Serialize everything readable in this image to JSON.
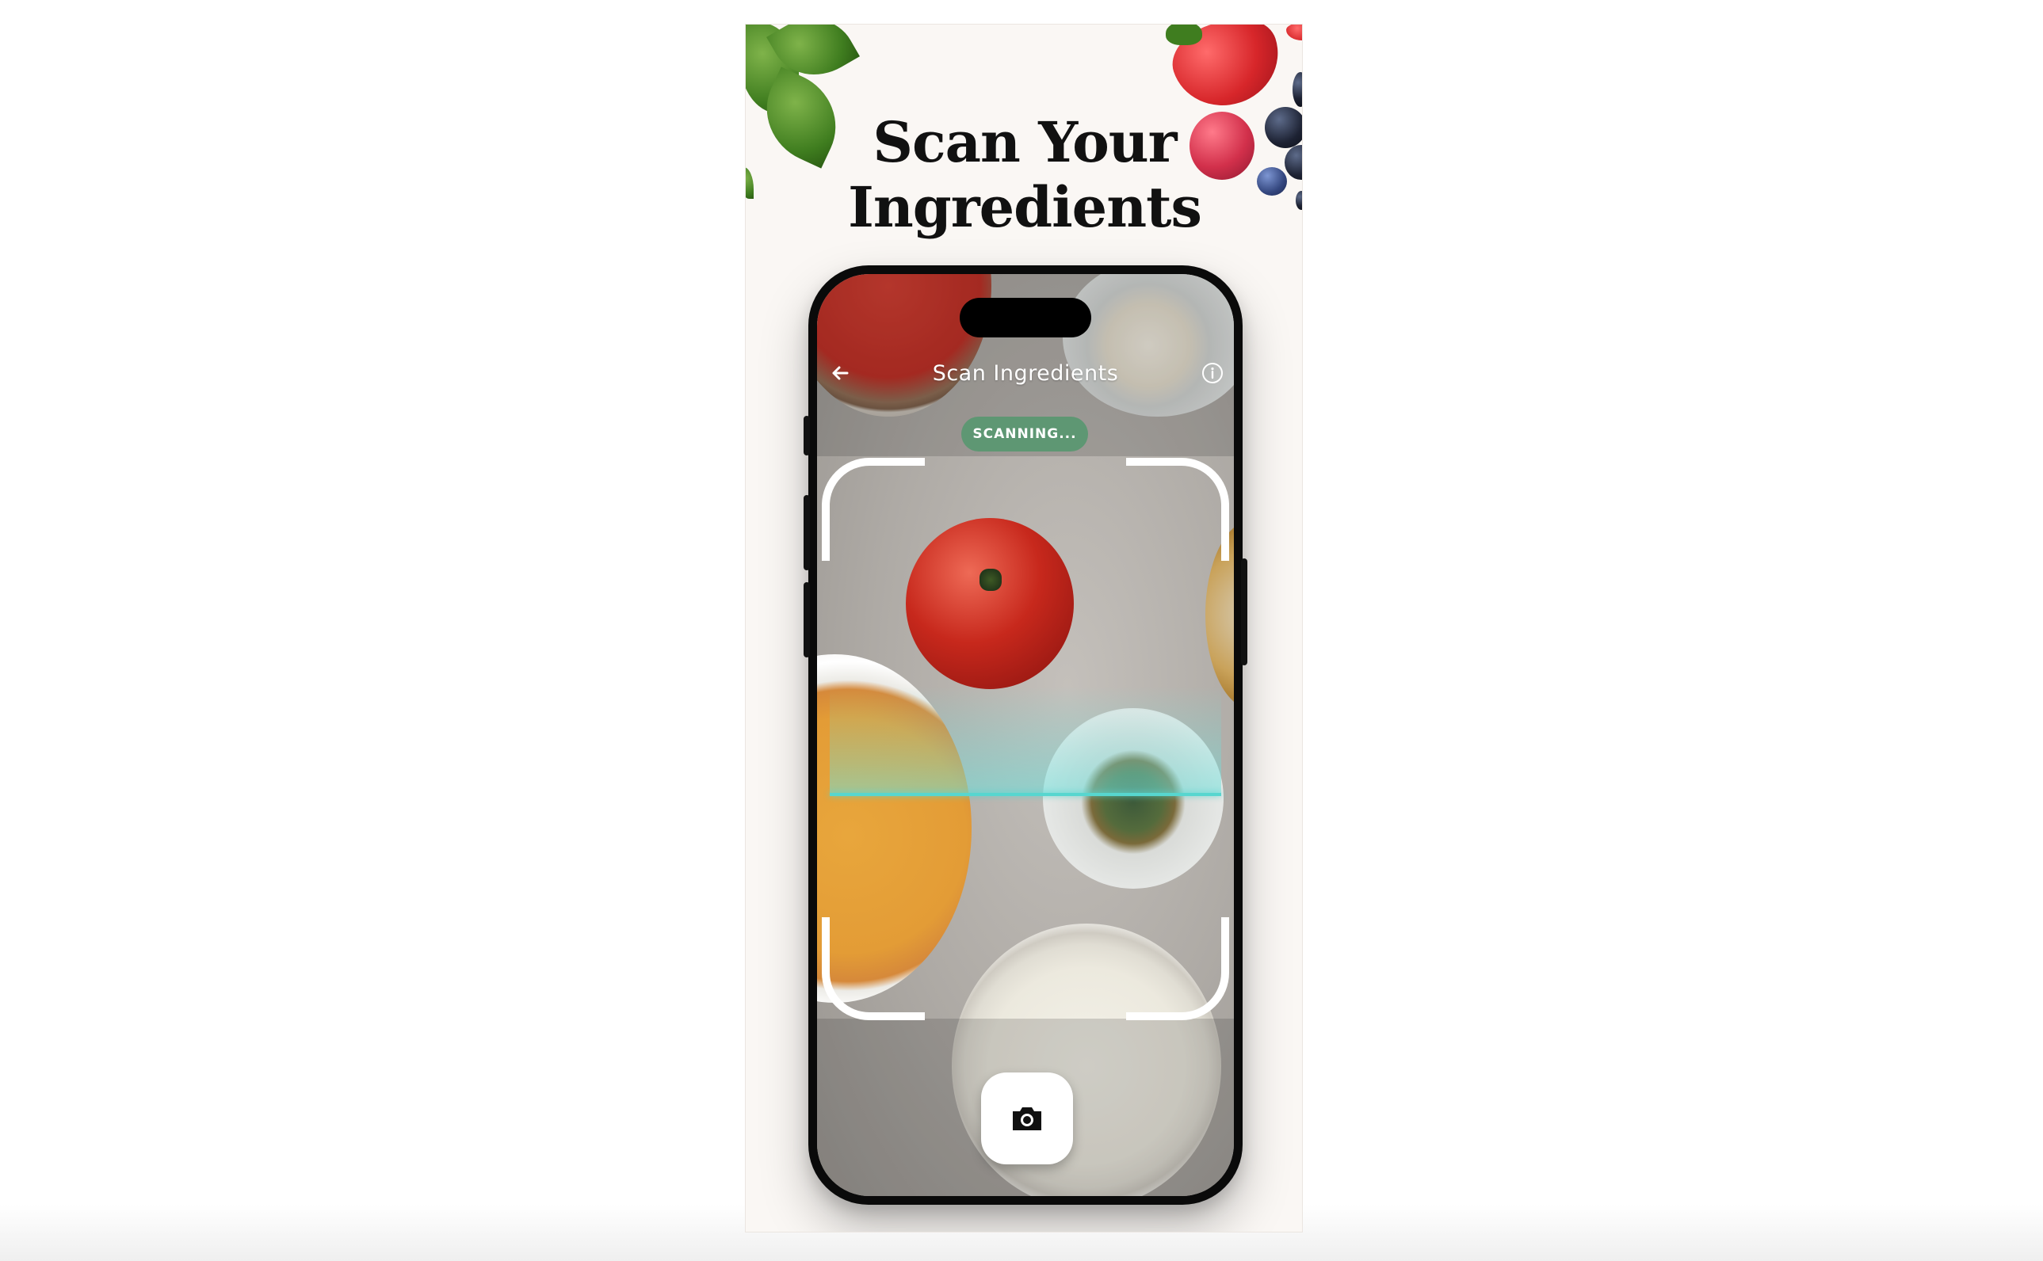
{
  "promo": {
    "title_line1": "Scan Your",
    "title_line2": "Ingredients"
  },
  "app": {
    "header_title": "Scan Ingredients",
    "status_badge": "SCANNING...",
    "back_icon": "arrow-left-icon",
    "info_icon": "info-icon",
    "capture_icon": "camera-icon"
  },
  "colors": {
    "badge": "#5e9773",
    "scan_line": "#57d6cf",
    "background": "#faf7f4"
  }
}
